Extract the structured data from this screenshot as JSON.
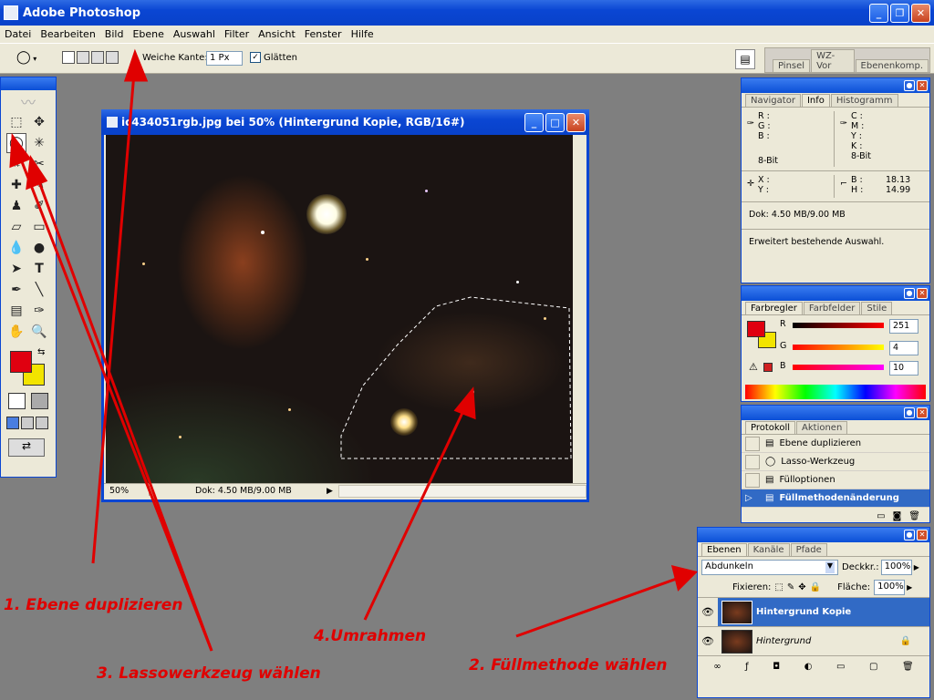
{
  "app": {
    "title": "Adobe Photoshop"
  },
  "menu": [
    "Datei",
    "Bearbeiten",
    "Bild",
    "Ebene",
    "Auswahl",
    "Filter",
    "Ansicht",
    "Fenster",
    "Hilfe"
  ],
  "options": {
    "feather_label": "Weiche Kante:",
    "feather_value": "1 Px",
    "antialias_label": "Glätten",
    "tabs": [
      "Pinsel",
      "WZ-Vor",
      "Ebenenkomp."
    ]
  },
  "doc": {
    "title": "ic434051rgb.jpg bei 50% (Hintergrund Kopie, RGB/16#)",
    "zoom": "50%",
    "status": "Dok: 4.50 MB/9.00 MB"
  },
  "info_panel": {
    "tabs": [
      "Navigator",
      "Info",
      "Histogramm"
    ],
    "r": "R :",
    "g": "G :",
    "b": "B :",
    "c": "C :",
    "m": "M :",
    "y": "Y :",
    "k": "K :",
    "bit1": "8-Bit",
    "bit2": "8-Bit",
    "xlabel": "X :",
    "ylabel": "Y :",
    "blabel": "B :",
    "hlabel": "H :",
    "bval": "18.13",
    "hval": "14.99",
    "dok": "Dok: 4.50 MB/9.00 MB",
    "hint": "Erweitert bestehende Auswahl."
  },
  "color_panel": {
    "tabs": [
      "Farbregler",
      "Farbfelder",
      "Stile"
    ],
    "r_label": "R",
    "g_label": "G",
    "b_label": "B",
    "r": "251",
    "g": "4",
    "b": "10",
    "fg": "#fb040a",
    "bg": "#f2d600"
  },
  "history_panel": {
    "tabs": [
      "Protokoll",
      "Aktionen"
    ],
    "items": [
      "Ebene duplizieren",
      "Lasso-Werkzeug",
      "Fülloptionen",
      "Füllmethodenänderung"
    ]
  },
  "layers_panel": {
    "tabs": [
      "Ebenen",
      "Kanäle",
      "Pfade"
    ],
    "blend": "Abdunkeln",
    "opacity_label": "Deckkr.:",
    "opacity": "100%",
    "lock_label": "Fixieren:",
    "fill_label": "Fläche:",
    "fill": "100%",
    "layers": [
      "Hintergrund Kopie",
      "Hintergrund"
    ]
  },
  "annotations": [
    "1. Ebene duplizieren",
    "2. Füllmethode wählen",
    "3. Lassowerkzeug wählen",
    "4.Umrahmen"
  ],
  "colors": {
    "accent": "#0a46d3",
    "annot": "#e00000"
  }
}
